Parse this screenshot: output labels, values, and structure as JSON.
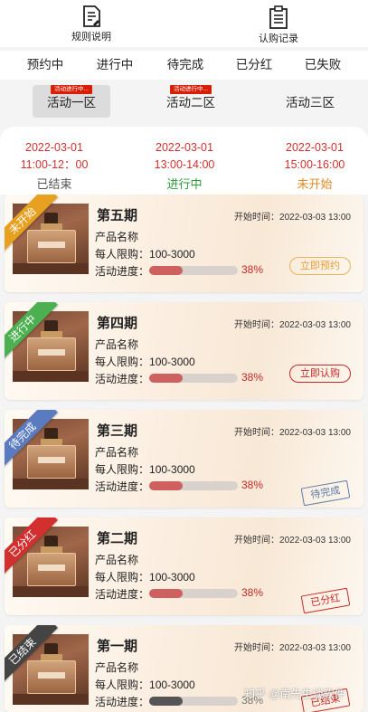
{
  "header": {
    "rules": {
      "label": "规则说明",
      "icon": "document-icon"
    },
    "record": {
      "label": "认购记录",
      "icon": "clipboard-icon"
    }
  },
  "status_tabs": [
    "预约中",
    "进行中",
    "待完成",
    "已分红",
    "已失败"
  ],
  "zone_tabs": [
    {
      "label": "活动一区",
      "tag": "活动进行中...",
      "active": true
    },
    {
      "label": "活动二区",
      "tag": "活动进行中...",
      "active": false
    },
    {
      "label": "活动三区",
      "tag": "",
      "active": false
    }
  ],
  "sessions": [
    {
      "date": "2022-03-01",
      "time": "11:00-12：00",
      "status": "已结束",
      "color": "#555555"
    },
    {
      "date": "2022-03-01",
      "time": "13:00-14:00",
      "status": "进行中",
      "color": "#2e9b3a"
    },
    {
      "date": "2022-03-01",
      "time": "15:00-16:00",
      "status": "未开始",
      "color": "#e08a1e"
    }
  ],
  "cards": [
    {
      "ribbon": "未开始",
      "ribbon_color": "#e8a020",
      "period": "第五期",
      "start_label": "开始时间：",
      "start_time": "2022-03-03  13:00",
      "product": "产品名称",
      "limit_label": "每人限购：",
      "limit": "100-3000",
      "progress_label": "活动进度：",
      "progress": 38,
      "progress_text": "38%",
      "action": "立即预约",
      "action_type": "book"
    },
    {
      "ribbon": "进行中",
      "ribbon_color": "#4caf50",
      "period": "第四期",
      "start_label": "开始时间：",
      "start_time": "2022-03-03  13:00",
      "product": "产品名称",
      "limit_label": "每人限购：",
      "limit": "100-3000",
      "progress_label": "活动进度：",
      "progress": 38,
      "progress_text": "38%",
      "action": "立即认购",
      "action_type": "buy"
    },
    {
      "ribbon": "待完成",
      "ribbon_color": "#5b7bc0",
      "period": "第三期",
      "start_label": "开始时间：",
      "start_time": "2022-03-03  13:00",
      "product": "产品名称",
      "limit_label": "每人限购：",
      "limit": "100-3000",
      "progress_label": "活动进度：",
      "progress": 38,
      "progress_text": "38%",
      "action": "待完成",
      "action_type": "stamp-blue"
    },
    {
      "ribbon": "已分红",
      "ribbon_color": "#d32f2f",
      "period": "第二期",
      "start_label": "开始时间：",
      "start_time": "2022-03-03  13:00",
      "product": "产品名称",
      "limit_label": "每人限购：",
      "limit": "100-3000",
      "progress_label": "活动进度：",
      "progress": 38,
      "progress_text": "38%",
      "action": "已分红",
      "action_type": "stamp-red"
    },
    {
      "ribbon": "已结束",
      "ribbon_color": "#444444",
      "period": "第一期",
      "start_label": "开始时间：",
      "start_time": "2022-03-03  13:00",
      "product": "产品名称",
      "limit_label": "每人限购：",
      "limit": "100-3000",
      "progress_label": "活动进度：",
      "progress": 38,
      "progress_text": "38%",
      "action": "已结束",
      "action_type": "stamp-red"
    }
  ],
  "watermark": "知乎 @南先生谈软件",
  "colors": {
    "accent_red": "#d32f2f",
    "progress_fill": "#cf6060",
    "progress_ended": "#555555"
  }
}
